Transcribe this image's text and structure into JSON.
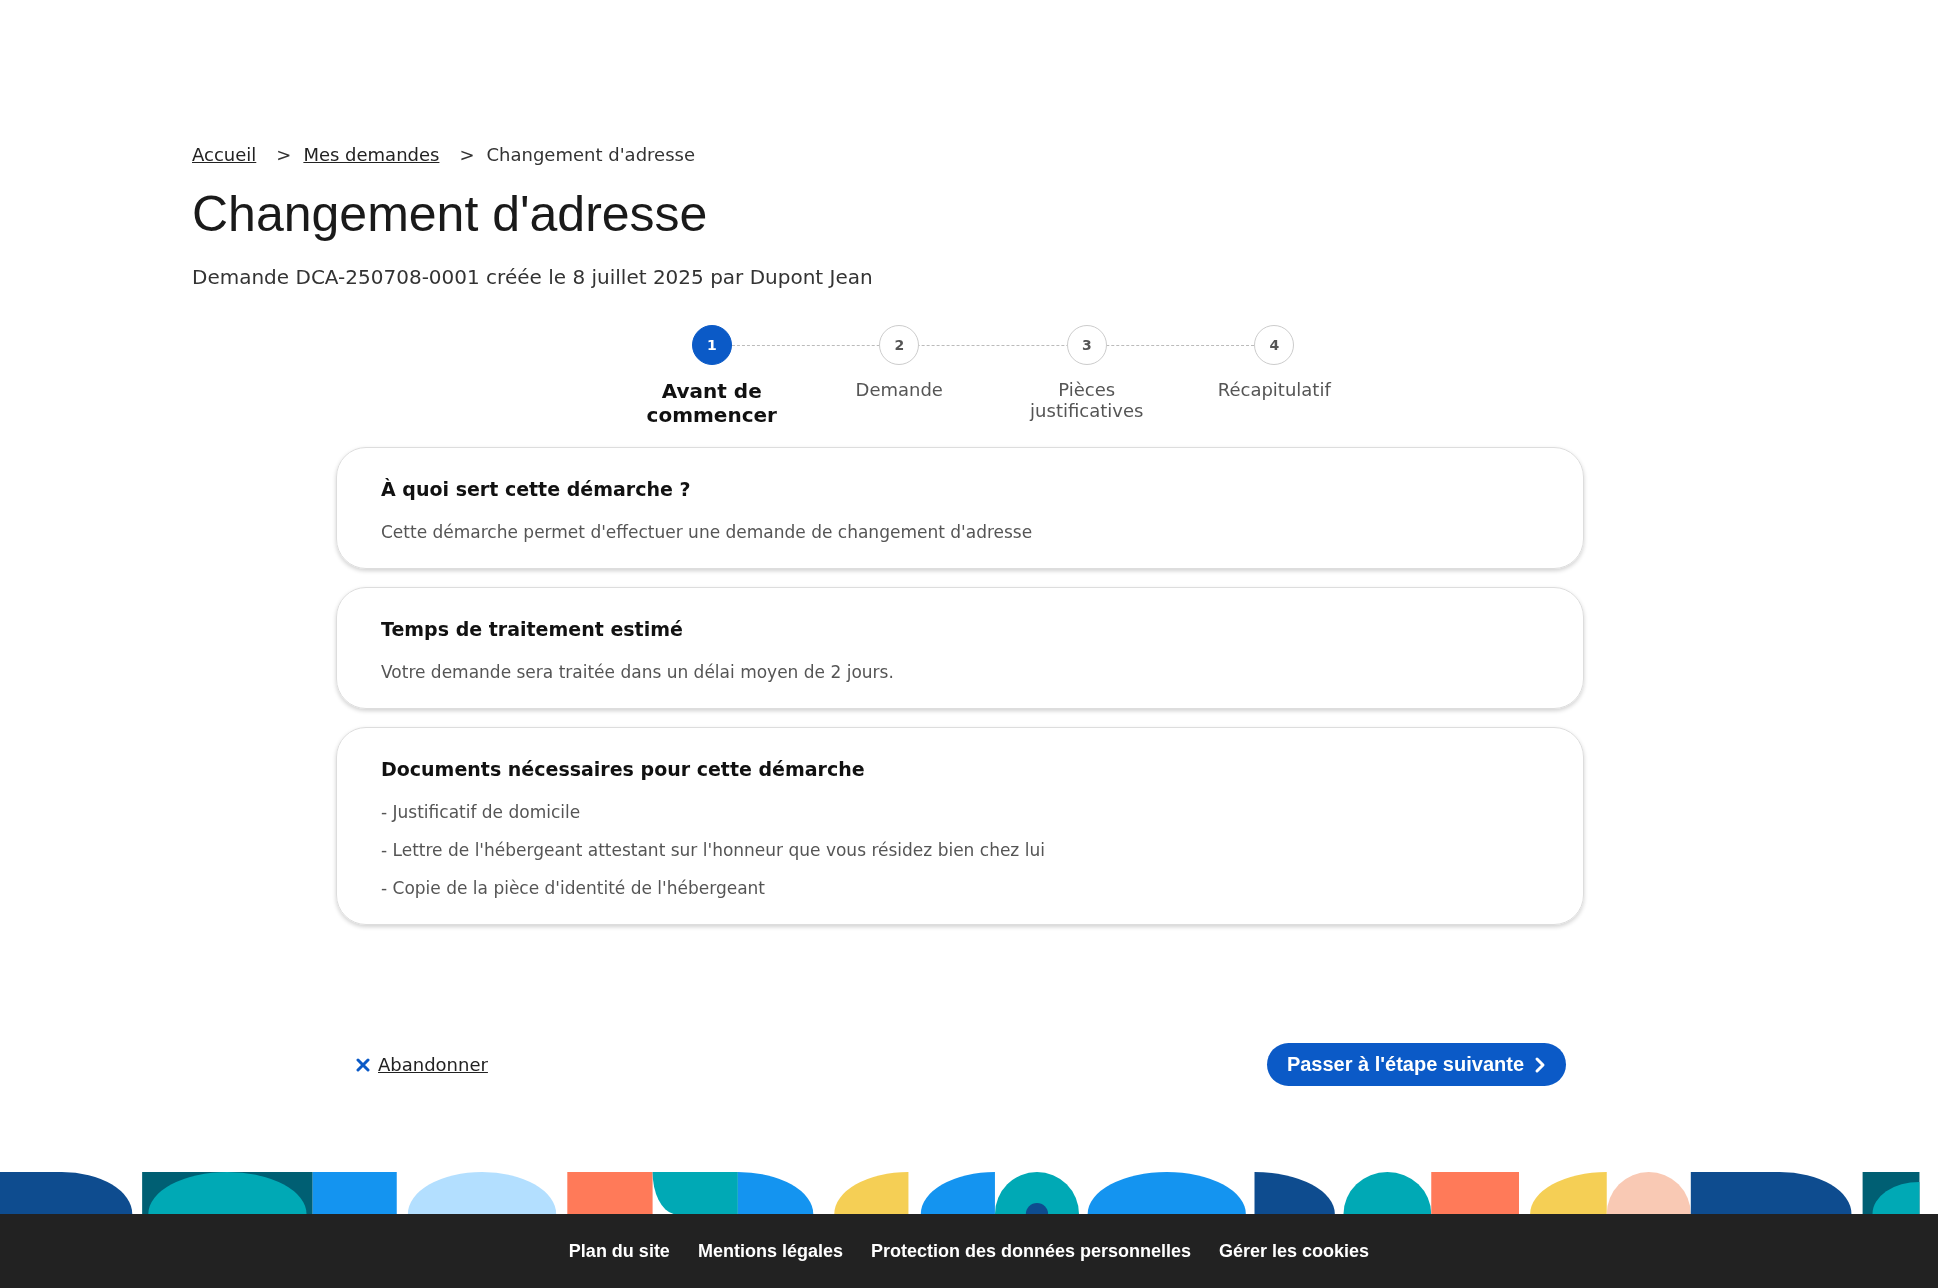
{
  "breadcrumb": [
    {
      "label": "Accueil",
      "link": true
    },
    {
      "label": "Mes demandes",
      "link": true
    },
    {
      "label": "Changement d'adresse",
      "link": false
    }
  ],
  "breadcrumb_separator": ">",
  "title": "Changement d'adresse",
  "subtitle": "Demande DCA-250708-0001 créée le 8 juillet 2025 par Dupont Jean",
  "steps": [
    {
      "number": "1",
      "label": "Avant de commencer",
      "selected": true
    },
    {
      "number": "2",
      "label": "Demande",
      "selected": false
    },
    {
      "number": "3",
      "label": "Pièces justificatives",
      "selected": false
    },
    {
      "number": "4",
      "label": "Récapitulatif",
      "selected": false
    }
  ],
  "cards": [
    {
      "title": "À quoi sert cette démarche ?",
      "lines": [
        "Cette démarche permet d'effectuer une demande de changement d'adresse"
      ]
    },
    {
      "title": "Temps de traitement estimé",
      "lines": [
        "Votre demande sera traitée dans un délai moyen de 2 jours."
      ]
    },
    {
      "title": "Documents nécessaires pour cette démarche",
      "lines": [
        "- Justificatif de domicile",
        "- Lettre de l'hébergeant attestant sur l'honneur que vous résidez bien chez lui",
        "- Copie de la pièce d'identité de l'hébergeant"
      ]
    }
  ],
  "abandon_link": "Abandonner",
  "next_button": "Passer à l'étape suivante",
  "footer_links": [
    "Plan du site",
    "Mentions légales",
    "Protection des données personnelles",
    "Gérer les cookies"
  ]
}
